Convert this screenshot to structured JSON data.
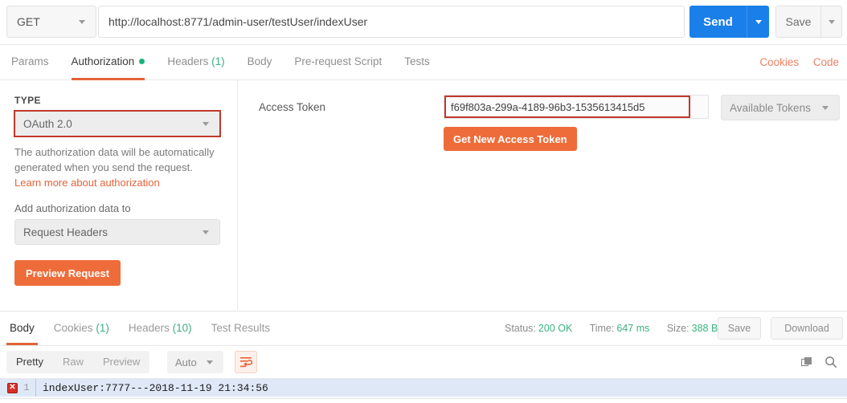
{
  "request_bar": {
    "method": "GET",
    "url": "http://localhost:8771/admin-user/testUser/indexUser",
    "send_label": "Send",
    "save_label": "Save"
  },
  "request_tabs": {
    "items": [
      {
        "label": "Params",
        "active": false,
        "count": "",
        "dot": false
      },
      {
        "label": "Authorization",
        "active": true,
        "count": "",
        "dot": true
      },
      {
        "label": "Headers",
        "active": false,
        "count": "(1)",
        "dot": false
      },
      {
        "label": "Body",
        "active": false,
        "count": "",
        "dot": false
      },
      {
        "label": "Pre-request Script",
        "active": false,
        "count": "",
        "dot": false
      },
      {
        "label": "Tests",
        "active": false,
        "count": "",
        "dot": false
      }
    ],
    "cookies_link": "Cookies",
    "code_link": "Code"
  },
  "authorization": {
    "type_label": "TYPE",
    "type_value": "OAuth 2.0",
    "description_text": "The authorization data will be automatically generated when you send the request. ",
    "description_link": "Learn more about authorization",
    "add_data_label": "Add authorization data to",
    "add_data_value": "Request Headers",
    "preview_button": "Preview Request",
    "access_token_label": "Access Token",
    "access_token_value": "f69f803a-299a-4189-96b3-1535613415d5",
    "available_tokens_value": "Available Tokens",
    "get_token_button": "Get New Access Token"
  },
  "response_tabs": {
    "items": [
      {
        "label": "Body",
        "active": true,
        "count": ""
      },
      {
        "label": "Cookies",
        "active": false,
        "count": "(1)"
      },
      {
        "label": "Headers",
        "active": false,
        "count": "(10)"
      },
      {
        "label": "Test Results",
        "active": false,
        "count": ""
      }
    ],
    "status_label": "Status:",
    "status_value": "200 OK",
    "time_label": "Time:",
    "time_value": "647 ms",
    "size_label": "Size:",
    "size_value": "388 B",
    "save_label": "Save",
    "download_label": "Download"
  },
  "view_toolbar": {
    "pretty": "Pretty",
    "raw": "Raw",
    "preview": "Preview",
    "format_value": "Auto"
  },
  "response_body": {
    "error_marker": "✕",
    "line_number": "1",
    "content": "indexUser:7777---2018-11-19 21:34:56"
  },
  "colors": {
    "send_blue": "#1a7fe8",
    "accent_orange": "#ee6c3a",
    "tab_underline": "#e4633a",
    "link_salmon": "#ec8263",
    "status_green": "#39b27e",
    "highlight_red": "#c0392b",
    "selection_blue": "#dfe8f7"
  }
}
